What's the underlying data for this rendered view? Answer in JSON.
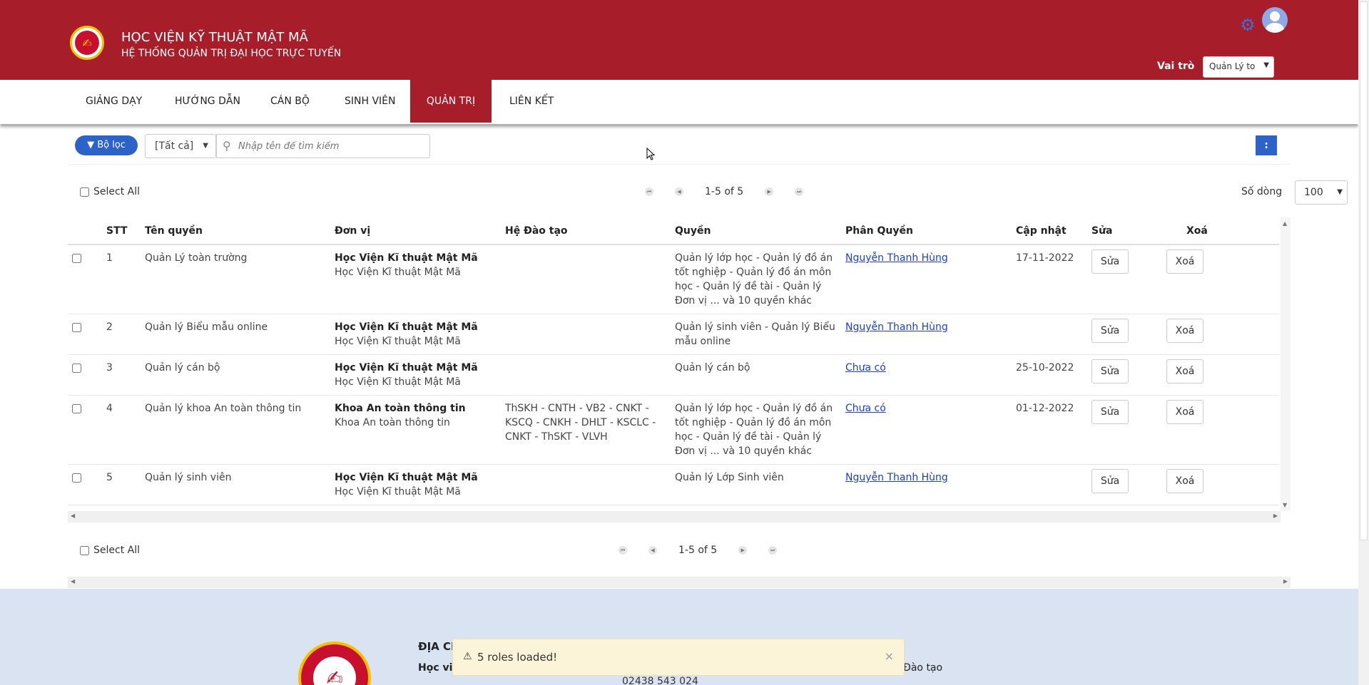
{
  "header": {
    "title": "HỌC VIỆN KỸ THUẬT MẬT MÃ",
    "subtitle": "HỆ THỐNG QUẢN TRỊ ĐẠI HỌC TRỰC TUYẾN",
    "role_label": "Vai trò",
    "role_value": "Quản Lý to"
  },
  "nav": {
    "items": [
      "GIẢNG DẠY",
      "HƯỚNG DẪN",
      "CÁN BỘ",
      "SINH VIÊN",
      "QUẢN TRỊ",
      "LIÊN KẾT"
    ],
    "active_index": 4
  },
  "toolbar": {
    "filter_label": "Bộ lọc",
    "scope_value": "[Tất cả]",
    "search_placeholder": "Nhập tên để tìm kiếm",
    "more_label": ":"
  },
  "grid": {
    "select_all_label": "Select All",
    "pagination_text": "1-5 of 5",
    "rows_label": "Số dòng",
    "rows_value": "100",
    "columns": [
      "",
      "STT",
      "Tên quyền",
      "Đơn vị",
      "Hệ Đào tạo",
      "Quyền",
      "Phân Quyền",
      "Cập nhật",
      "Sửa",
      "Xoá"
    ],
    "edit_label": "Sửa",
    "delete_label": "Xoá",
    "rows": [
      {
        "stt": "1",
        "name": "Quản Lý toàn trường",
        "unit_bold": "Học Viện Kĩ thuật Mật Mã",
        "unit": "Học Viện Kĩ thuật Mật Mã",
        "training": "",
        "permissions": "Quản lý lớp học - Quản lý đồ án tốt nghiệp - Quản lý đồ án môn học - Quản lý đề tài - Quản lý Đơn vị ... và 10 quyền khác",
        "assignee": "Nguyễn Thanh Hùng",
        "updated": "17-11-2022"
      },
      {
        "stt": "2",
        "name": "Quản lý Biểu mẫu online",
        "unit_bold": "Học Viện Kĩ thuật Mật Mã",
        "unit": "Học Viện Kĩ thuật Mật Mã",
        "training": "",
        "permissions": "Quản lý sinh viên - Quản lý Biểu mẫu online",
        "assignee": "Nguyễn Thanh Hùng",
        "updated": ""
      },
      {
        "stt": "3",
        "name": "Quản lý cán bộ",
        "unit_bold": "Học Viện Kĩ thuật Mật Mã",
        "unit": "Học Viện Kĩ thuật Mật Mã",
        "training": "",
        "permissions": "Quản lý cán bộ",
        "assignee": "Chưa có",
        "updated": "25-10-2022"
      },
      {
        "stt": "4",
        "name": "Quản lý khoa An toàn thông tin",
        "unit_bold": "Khoa An toàn thông tin",
        "unit": "Khoa An toàn thông tin",
        "training": "ThSKH - CNTH - VB2 - CNKT - KSCQ - CNKH - DHLT - KSCLC - CNKT - ThSKT - VLVH",
        "permissions": "Quản lý lớp học - Quản lý đồ án tốt nghiệp - Quản lý đồ án môn học - Quản lý đề tài - Quản lý Đơn vị ... và 10 quyền khác",
        "assignee": "Chưa có",
        "updated": "01-12-2022"
      },
      {
        "stt": "5",
        "name": "Quản lý sinh viên",
        "unit_bold": "Học Viện Kĩ thuật Mật Mã",
        "unit": "Học Viện Kĩ thuật Mật Mã",
        "training": "",
        "permissions": "Quản lý Lớp Sinh viên",
        "assignee": "Nguyễn Thanh Hùng",
        "updated": ""
      }
    ]
  },
  "footer": {
    "heading": "ĐỊA CH",
    "address_prefix": "Học việ",
    "right_text": "Đào tạo",
    "phone": "02438 543 024"
  },
  "toast": {
    "message": "5 roles loaded!",
    "close": "×"
  },
  "colors": {
    "brand_red": "#a71d2a",
    "primary_blue": "#2d63c8",
    "link_blue": "#1a3fd0",
    "footer_bg": "#d9e3f2",
    "toast_bg": "#fcf4d8"
  }
}
